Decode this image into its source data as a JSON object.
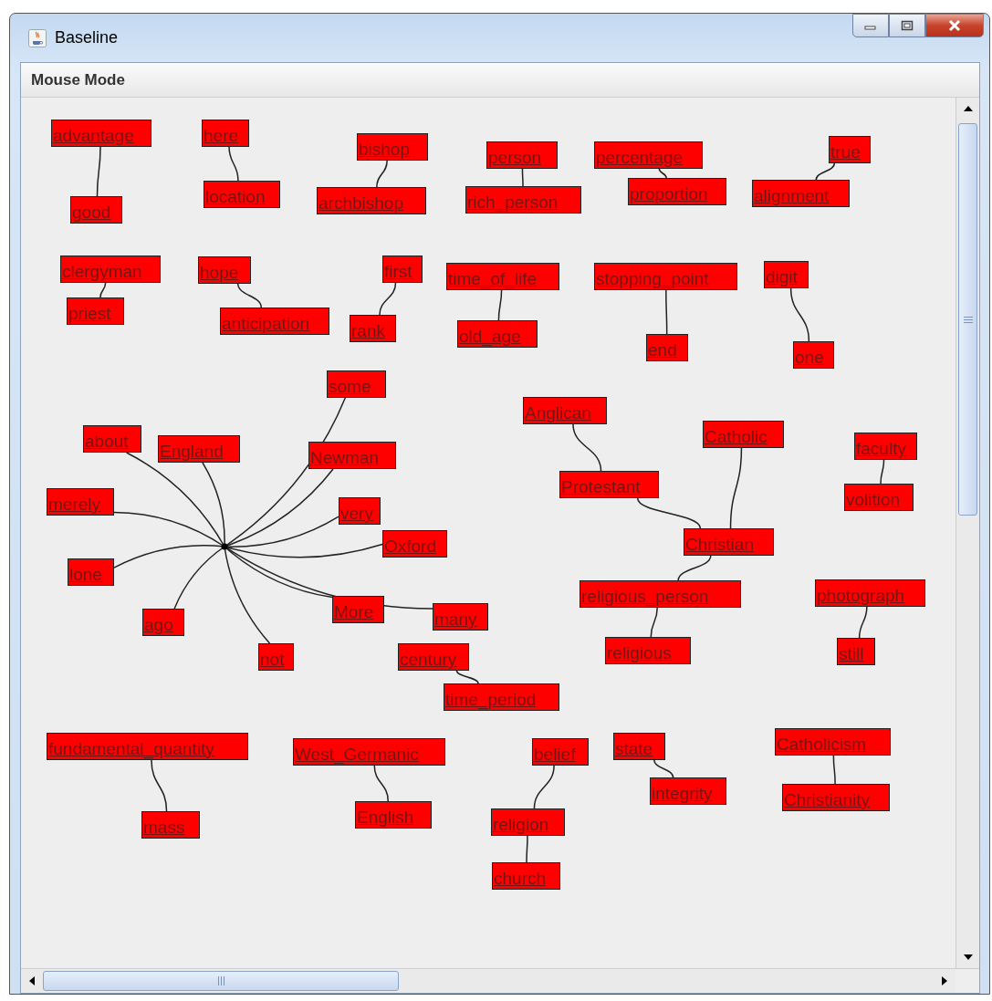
{
  "window": {
    "title": "Baseline"
  },
  "menu": [
    "Mouse Mode"
  ],
  "graph": {
    "clusters": [
      {
        "kind": "node",
        "label": "advantage",
        "children": [
          {
            "label": "good"
          }
        ]
      },
      {
        "kind": "node",
        "label": "here",
        "children": [
          {
            "label": "location"
          }
        ]
      },
      {
        "kind": "node",
        "label": "bishop",
        "children": [
          {
            "label": "archbishop"
          }
        ]
      },
      {
        "kind": "node",
        "label": "person",
        "children": [
          {
            "label": "rich_person"
          }
        ]
      },
      {
        "kind": "node",
        "label": "percentage",
        "children": [
          {
            "label": "proportion"
          }
        ]
      },
      {
        "kind": "node",
        "label": "true",
        "children": [
          {
            "label": "alignment"
          }
        ]
      },
      {
        "kind": "node",
        "label": "clergyman",
        "children": [
          {
            "label": "priest"
          }
        ]
      },
      {
        "kind": "node",
        "label": "hope",
        "children": [
          {
            "label": "anticipation"
          }
        ]
      },
      {
        "kind": "node",
        "label": "first",
        "children": [
          {
            "label": "rank"
          }
        ]
      },
      {
        "kind": "node",
        "label": "time_of_life",
        "children": [
          {
            "label": "old_age"
          }
        ]
      },
      {
        "kind": "node",
        "label": "stopping_point",
        "children": [
          {
            "label": "end"
          }
        ]
      },
      {
        "kind": "node",
        "label": "digit",
        "children": [
          {
            "label": "one"
          }
        ]
      },
      {
        "kind": "hub",
        "children": [
          {
            "label": "some"
          },
          {
            "label": "about"
          },
          {
            "label": "England"
          },
          {
            "label": "Newman"
          },
          {
            "label": "merely"
          },
          {
            "label": "very"
          },
          {
            "label": "Oxford"
          },
          {
            "label": "lone"
          },
          {
            "label": "ago"
          },
          {
            "label": "More"
          },
          {
            "label": "many"
          },
          {
            "label": "not"
          }
        ]
      },
      {
        "kind": "node",
        "label": "Christian",
        "children": [
          {
            "label": "Protestant",
            "children": [
              {
                "label": "Anglican"
              }
            ]
          },
          {
            "label": "Catholic"
          },
          {
            "label": "religious_person",
            "children": [
              {
                "label": "religious"
              }
            ]
          }
        ]
      },
      {
        "kind": "node",
        "label": "faculty",
        "children": [
          {
            "label": "volition"
          }
        ]
      },
      {
        "kind": "node",
        "label": "photograph",
        "children": [
          {
            "label": "still"
          }
        ]
      },
      {
        "kind": "node",
        "label": "century",
        "children": [
          {
            "label": "time_period"
          }
        ]
      },
      {
        "kind": "node",
        "label": "fundamental_quantity",
        "children": [
          {
            "label": "mass"
          }
        ]
      },
      {
        "kind": "node",
        "label": "West_Germanic",
        "children": [
          {
            "label": "English"
          }
        ]
      },
      {
        "kind": "node",
        "label": "religion",
        "children": [
          {
            "label": "belief"
          },
          {
            "label": "church"
          }
        ]
      },
      {
        "kind": "node",
        "label": "state",
        "children": [
          {
            "label": "integrity"
          }
        ]
      },
      {
        "kind": "node",
        "label": "Catholicism",
        "children": [
          {
            "label": "Christianity"
          }
        ]
      }
    ]
  }
}
